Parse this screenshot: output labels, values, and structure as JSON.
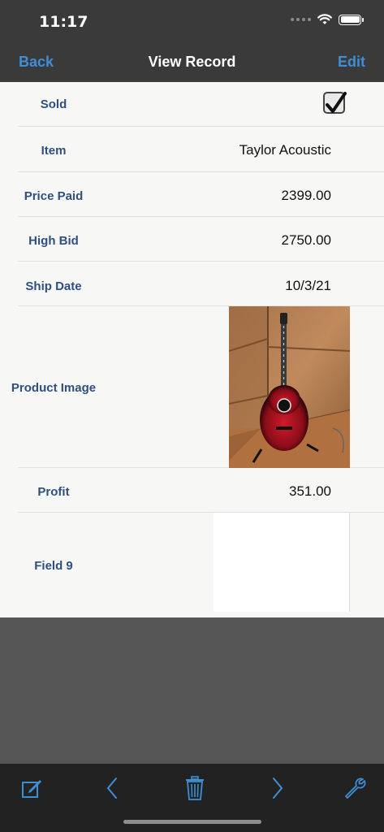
{
  "status": {
    "time": "11:17"
  },
  "nav": {
    "back": "Back",
    "title": "View Record",
    "edit": "Edit"
  },
  "fields": {
    "sold": {
      "label": "Sold",
      "checked": true
    },
    "item": {
      "label": "Item",
      "value": "Taylor Acoustic"
    },
    "price_paid": {
      "label": "Price Paid",
      "value": "2399.00"
    },
    "high_bid": {
      "label": "High Bid",
      "value": "2750.00"
    },
    "ship_date": {
      "label": "Ship Date",
      "value": "10/3/21"
    },
    "product_image": {
      "label": "Product Image",
      "image": "acoustic guitar photo"
    },
    "profit": {
      "label": "Profit",
      "value": "351.00"
    },
    "field9": {
      "label": "Field 9",
      "value": ""
    }
  },
  "toolbar": {
    "icons": [
      "edit-icon",
      "chevron-left-icon",
      "trash-icon",
      "chevron-right-icon",
      "wrench-icon"
    ]
  },
  "colors": {
    "accent": "#3d8fd6",
    "label": "#2f4f7f",
    "bar": "#3a3a3a",
    "toolbar": "#222222"
  }
}
